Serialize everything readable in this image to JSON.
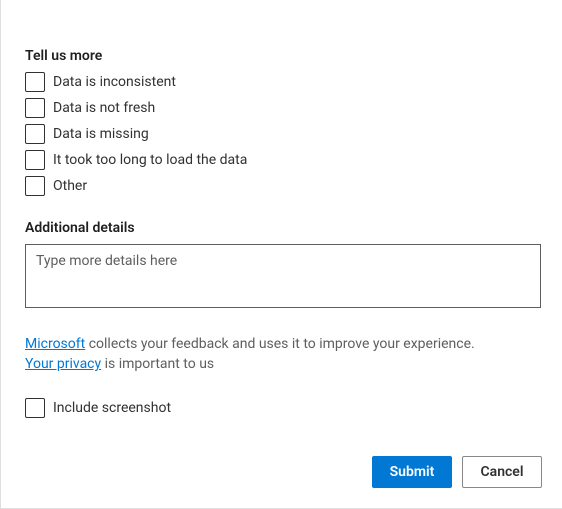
{
  "headings": {
    "tell_us_more": "Tell us more",
    "additional_details": "Additional details"
  },
  "checkboxes": {
    "inconsistent": "Data is inconsistent",
    "not_fresh": "Data is not fresh",
    "missing": "Data is missing",
    "too_long": "It took too long to load the data",
    "other": "Other"
  },
  "details": {
    "placeholder": "Type more details here",
    "value": ""
  },
  "legal": {
    "link1_text": "Microsoft",
    "text1": " collects your feedback and uses it to improve your experience. ",
    "link2_text": "Your privacy",
    "text2": " is important to us"
  },
  "screenshot": {
    "label": "Include screenshot"
  },
  "buttons": {
    "submit": "Submit",
    "cancel": "Cancel"
  }
}
